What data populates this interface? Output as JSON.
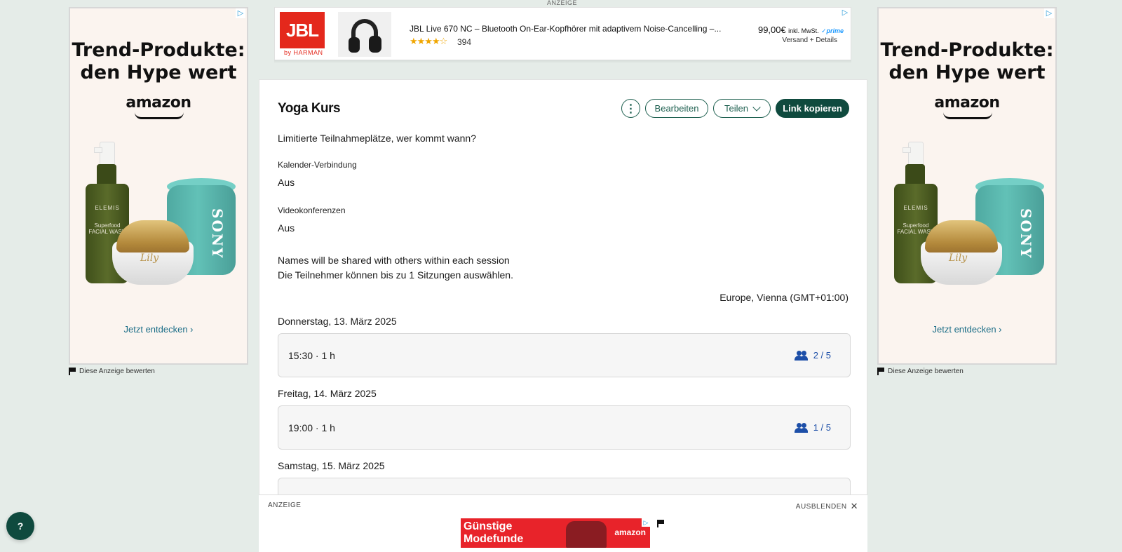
{
  "ads": {
    "top_label": "ANZEIGE",
    "ad_choice_glyph": "▷",
    "side": {
      "headline_line1": "Trend-Produkte:",
      "headline_line2": "den Hype wert",
      "brand": "amazon",
      "cta": "Jetzt entdecken ›",
      "bottle_brand": "ELEMIS",
      "bottle_product": "Superfood FACIAL WASH",
      "speaker_brand": "SONY",
      "jar_brand": "Lily",
      "rate_label": "Diese Anzeige bewerten"
    },
    "banner": {
      "logo_text": "JBL",
      "logo_sub": "by HARMAN",
      "product": "JBL Live 670 NC – Bluetooth On-Ear-Kopfhörer mit adaptivem Noise-Cancelling –...",
      "stars": "★★★★☆",
      "rating": 4.5,
      "reviews": "394",
      "price": "99,00€",
      "tax": "inkl. MwSt.",
      "prime": "✓prime",
      "shipping": "Versand + Details"
    },
    "bottom": {
      "label": "ANZEIGE",
      "hide_label": "AUSBLENDEN",
      "close_glyph": "✕",
      "text_line1": "Günstige",
      "text_line2": "Modefunde",
      "brand": "amazon"
    }
  },
  "poll": {
    "title": "Yoga Kurs",
    "more_glyph": "⋮",
    "edit_label": "Bearbeiten",
    "share_label": "Teilen",
    "copy_label": "Link kopieren",
    "description": "Limitierte Teilnahmeplätze, wer kommt wann?",
    "calendar_label": "Kalender-Verbindung",
    "calendar_value": "Aus",
    "video_label": "Videokonferenzen",
    "video_value": "Aus",
    "note_line1": "Names will be shared with others within each session",
    "note_line2": "Die Teilnehmer können bis zu 1 Sitzungen auswählen.",
    "timezone": "Europe, Vienna (GMT+01:00)",
    "days": [
      {
        "date": "Donnerstag, 13. März 2025",
        "time": "15:30 · 1 h",
        "count": "2 / 5"
      },
      {
        "date": "Freitag, 14. März 2025",
        "time": "19:00 · 1 h",
        "count": "1 / 5"
      },
      {
        "date": "Samstag, 15. März 2025"
      }
    ]
  },
  "help_label": "?",
  "colors": {
    "page_bg": "#e5ece8",
    "primary": "#0f4a3e",
    "count_blue": "#1d4fa8"
  }
}
